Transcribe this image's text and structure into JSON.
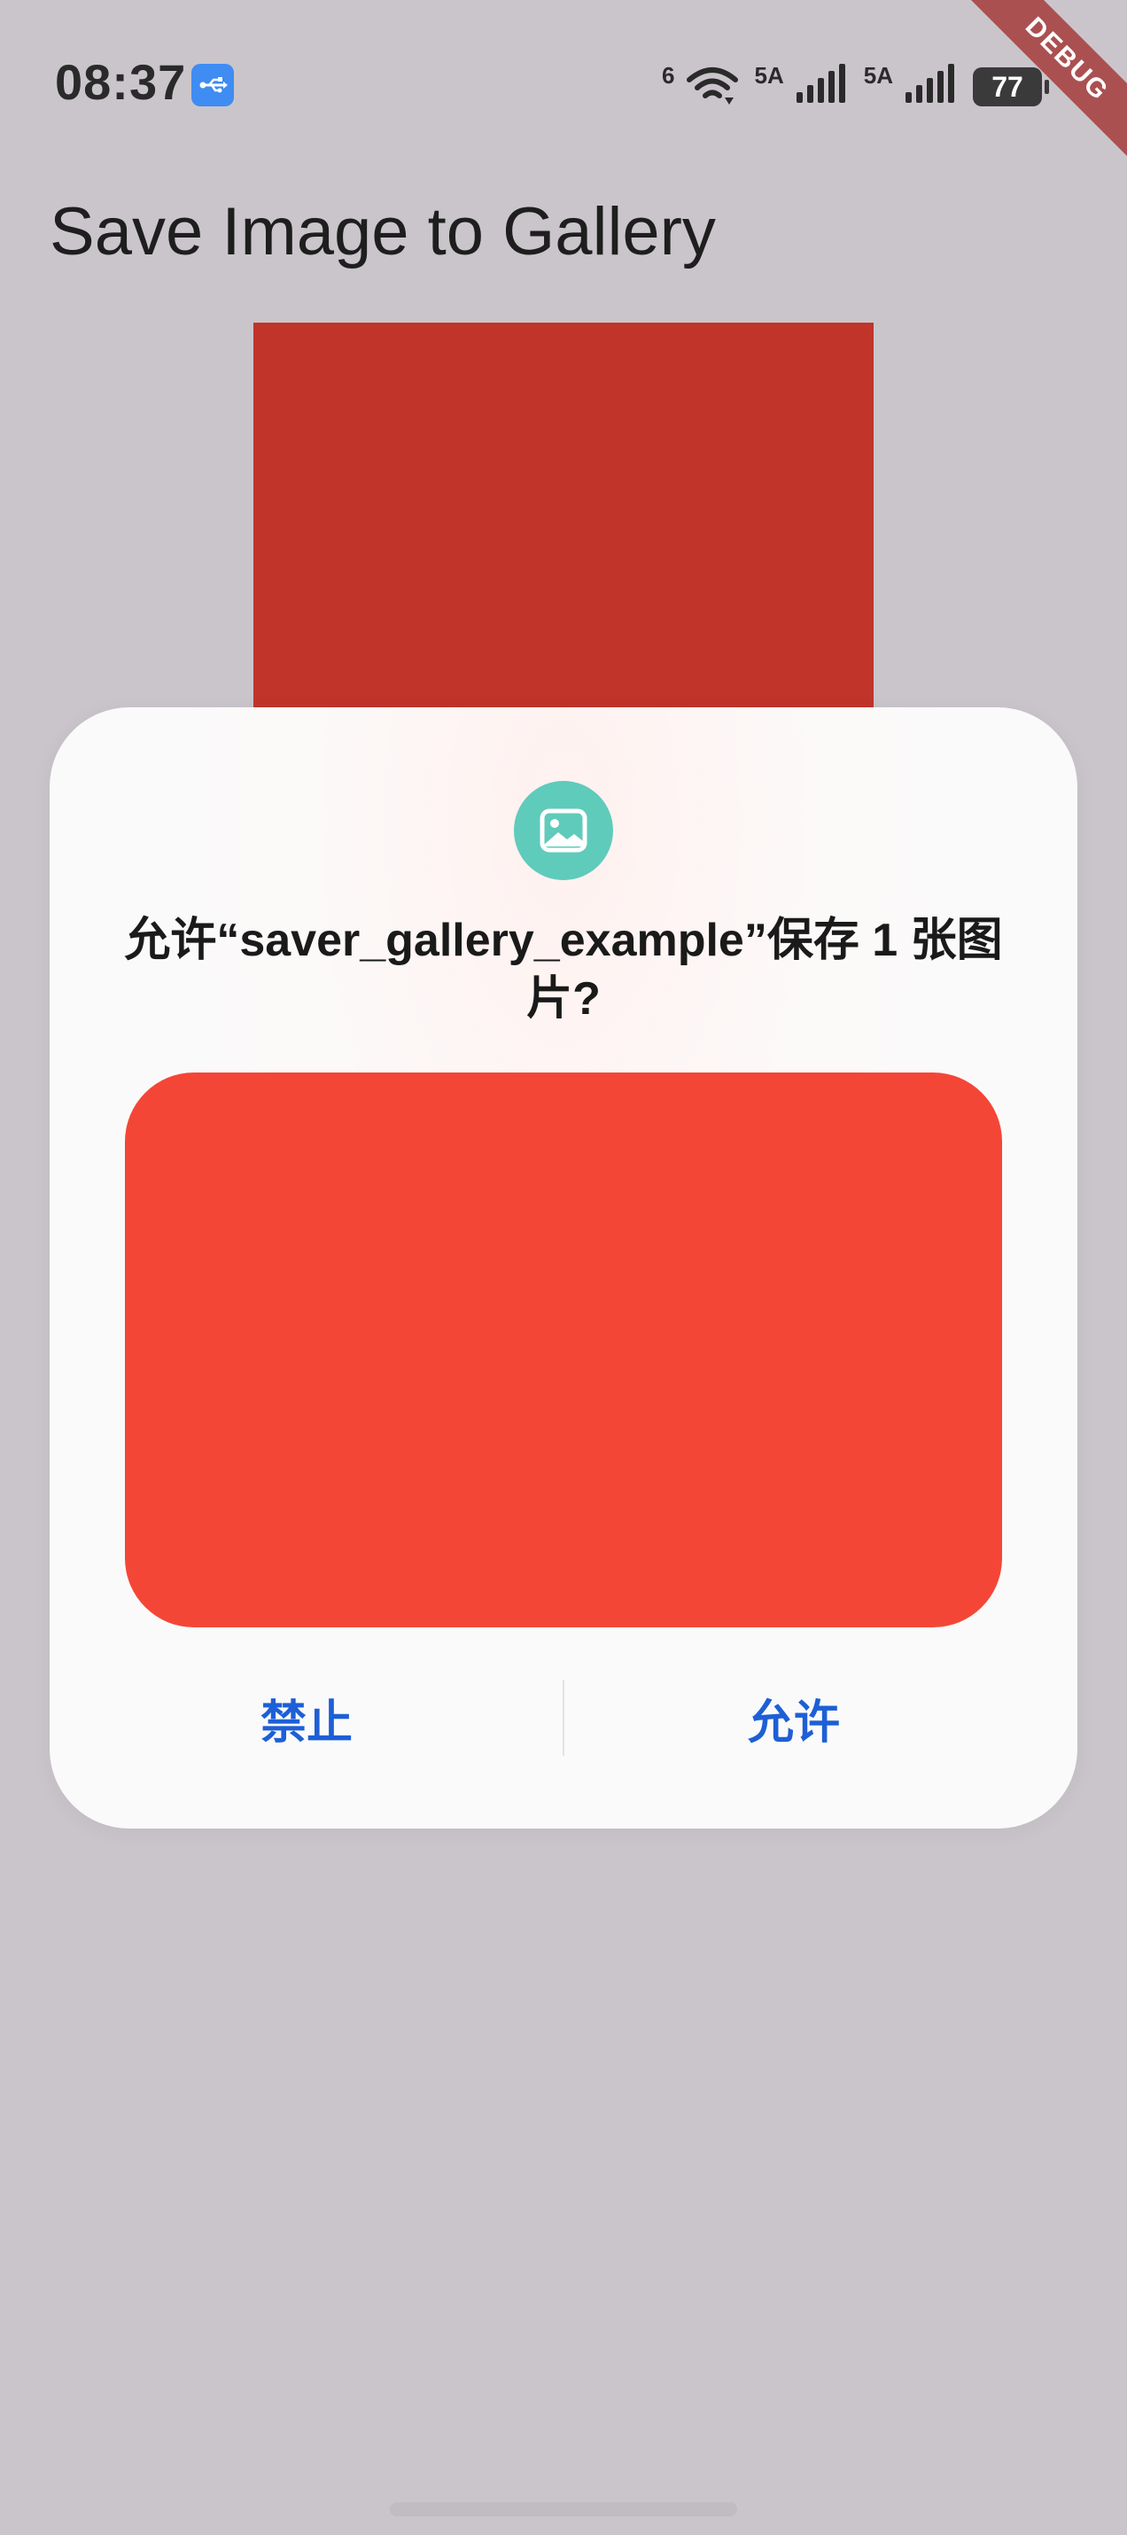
{
  "status_bar": {
    "time": "08:37",
    "wifi_label": "6",
    "signal1_label": "5A",
    "signal2_label": "5A",
    "battery": "77",
    "icons": [
      "usb-icon",
      "wifi-icon",
      "signal-icon",
      "signal-icon",
      "battery-icon"
    ]
  },
  "debug_banner": "DEBUG",
  "app_bar": {
    "title": "Save Image to Gallery"
  },
  "colors": {
    "background": "#cac5cb",
    "preview_red": "#c0342a",
    "dialog_image_red": "#f44637",
    "accent_blue": "#1d5fd6",
    "icon_teal": "#5fcbbb"
  },
  "dialog": {
    "icon": "image-icon",
    "title": "允许“saver_gallery_example”保存 1 张图片?",
    "deny_label": "禁止",
    "allow_label": "允许"
  }
}
